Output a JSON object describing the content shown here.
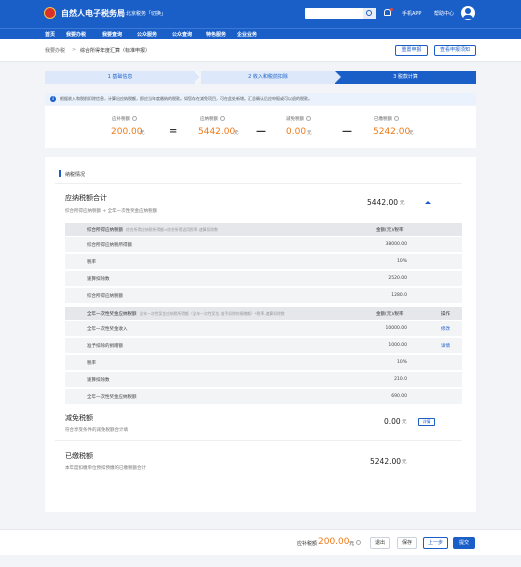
{
  "header": {
    "site_title": "自然人电子税务局",
    "region": "北京税务「切换」",
    "phone_app": "手机APP",
    "help_center": "帮助中心",
    "colors": {
      "brand_blue": "#1a5fc8",
      "amount_orange": "#f07a16"
    }
  },
  "nav": {
    "items": [
      {
        "label": "首页"
      },
      {
        "label": "我要办税"
      },
      {
        "label": "我要查询"
      },
      {
        "label": "公众服务"
      },
      {
        "label": "公众查询"
      },
      {
        "label": "特色服务"
      },
      {
        "label": "企业业务"
      }
    ]
  },
  "titlebar": {
    "breadcrumb": "我要办税",
    "separator": ">",
    "page_title": "综合所得年度汇算（标准申报）",
    "reset_label": "重置申报",
    "notice_label": "查看申报须知"
  },
  "steps": [
    {
      "label": "1  基础信息",
      "state": "done"
    },
    {
      "label": "2  收入和税前扣除",
      "state": "done"
    },
    {
      "label": "3  税款计算",
      "state": "active"
    }
  ],
  "notice": {
    "icon": "info-icon",
    "text": "根据收入和税前扣除信息，计算出应纳税额，即应当年度缴纳的税款。如您存在减免项目，可在此处新增。汇总确认后应申报或可以退的税款。"
  },
  "summary": {
    "refund": {
      "label": "应补税额",
      "value": "200.00",
      "unit": "元"
    },
    "payable": {
      "label": "应纳税额",
      "value": "5442.00",
      "unit": "元"
    },
    "reduction": {
      "label": "减免税额",
      "value": "0.00",
      "unit": "元"
    },
    "paid": {
      "label": "已缴税额",
      "value": "5242.00",
      "unit": "元"
    },
    "op_equals": "=",
    "op_minus1": "—",
    "op_minus2": "—"
  },
  "detail": {
    "section_title": "纳税情况",
    "payable_block": {
      "title": "应纳税额合计",
      "subtitle": "综合所得应纳税额 + 全年一次性奖金应纳税额",
      "value": "5442.00",
      "unit": "元"
    },
    "table1": {
      "header": "综合所得应纳税额",
      "header_note": "综合所得应纳税所得额×综合所得适用税率-速算扣除数",
      "amount_header": "金额(元)/税率",
      "rows": [
        {
          "label": "综合所得应纳税所得额",
          "value": "38000.00"
        },
        {
          "label": "税率",
          "value": "10%"
        },
        {
          "label": "速算扣除数",
          "value": "2520.00"
        },
        {
          "label": "综合所得应纳税额",
          "value": "1280.0"
        }
      ]
    },
    "table2": {
      "header": "全年一次性奖金应纳税额",
      "header_note": "全年一次性奖金应纳税所得额（全年一次性奖金-准予扣除的捐赠额）*税率-速算扣除数",
      "amount_header": "金额(元)/税率",
      "op_header": "操作",
      "rows": [
        {
          "label": "全年一次性奖金收入",
          "value": "10000.00",
          "link": "修改"
        },
        {
          "label": "准予扣除的捐赠额",
          "value": "1000.00",
          "link": "详情"
        },
        {
          "label": "税率",
          "value": "10%",
          "link": ""
        },
        {
          "label": "速算扣除数",
          "value": "210.0",
          "link": ""
        },
        {
          "label": "全年一次性奖金应纳税额",
          "value": "690.00",
          "link": ""
        }
      ]
    },
    "reduction_block": {
      "title": "减免税额",
      "subtitle": "符合享受条件的减免税额合计填",
      "value": "0.00",
      "unit": "元",
      "detail_label": "详情"
    },
    "paid_block": {
      "title": "已缴税额",
      "subtitle": "本年度扣缴单位预扣预缴的已缴税额合计",
      "value": "5242.00",
      "unit": "元"
    }
  },
  "footer": {
    "label": "应补税额",
    "value": "200.00",
    "unit": "元",
    "exit_label": "退出",
    "save_label": "保存",
    "prev_label": "上一步",
    "submit_label": "提交"
  }
}
